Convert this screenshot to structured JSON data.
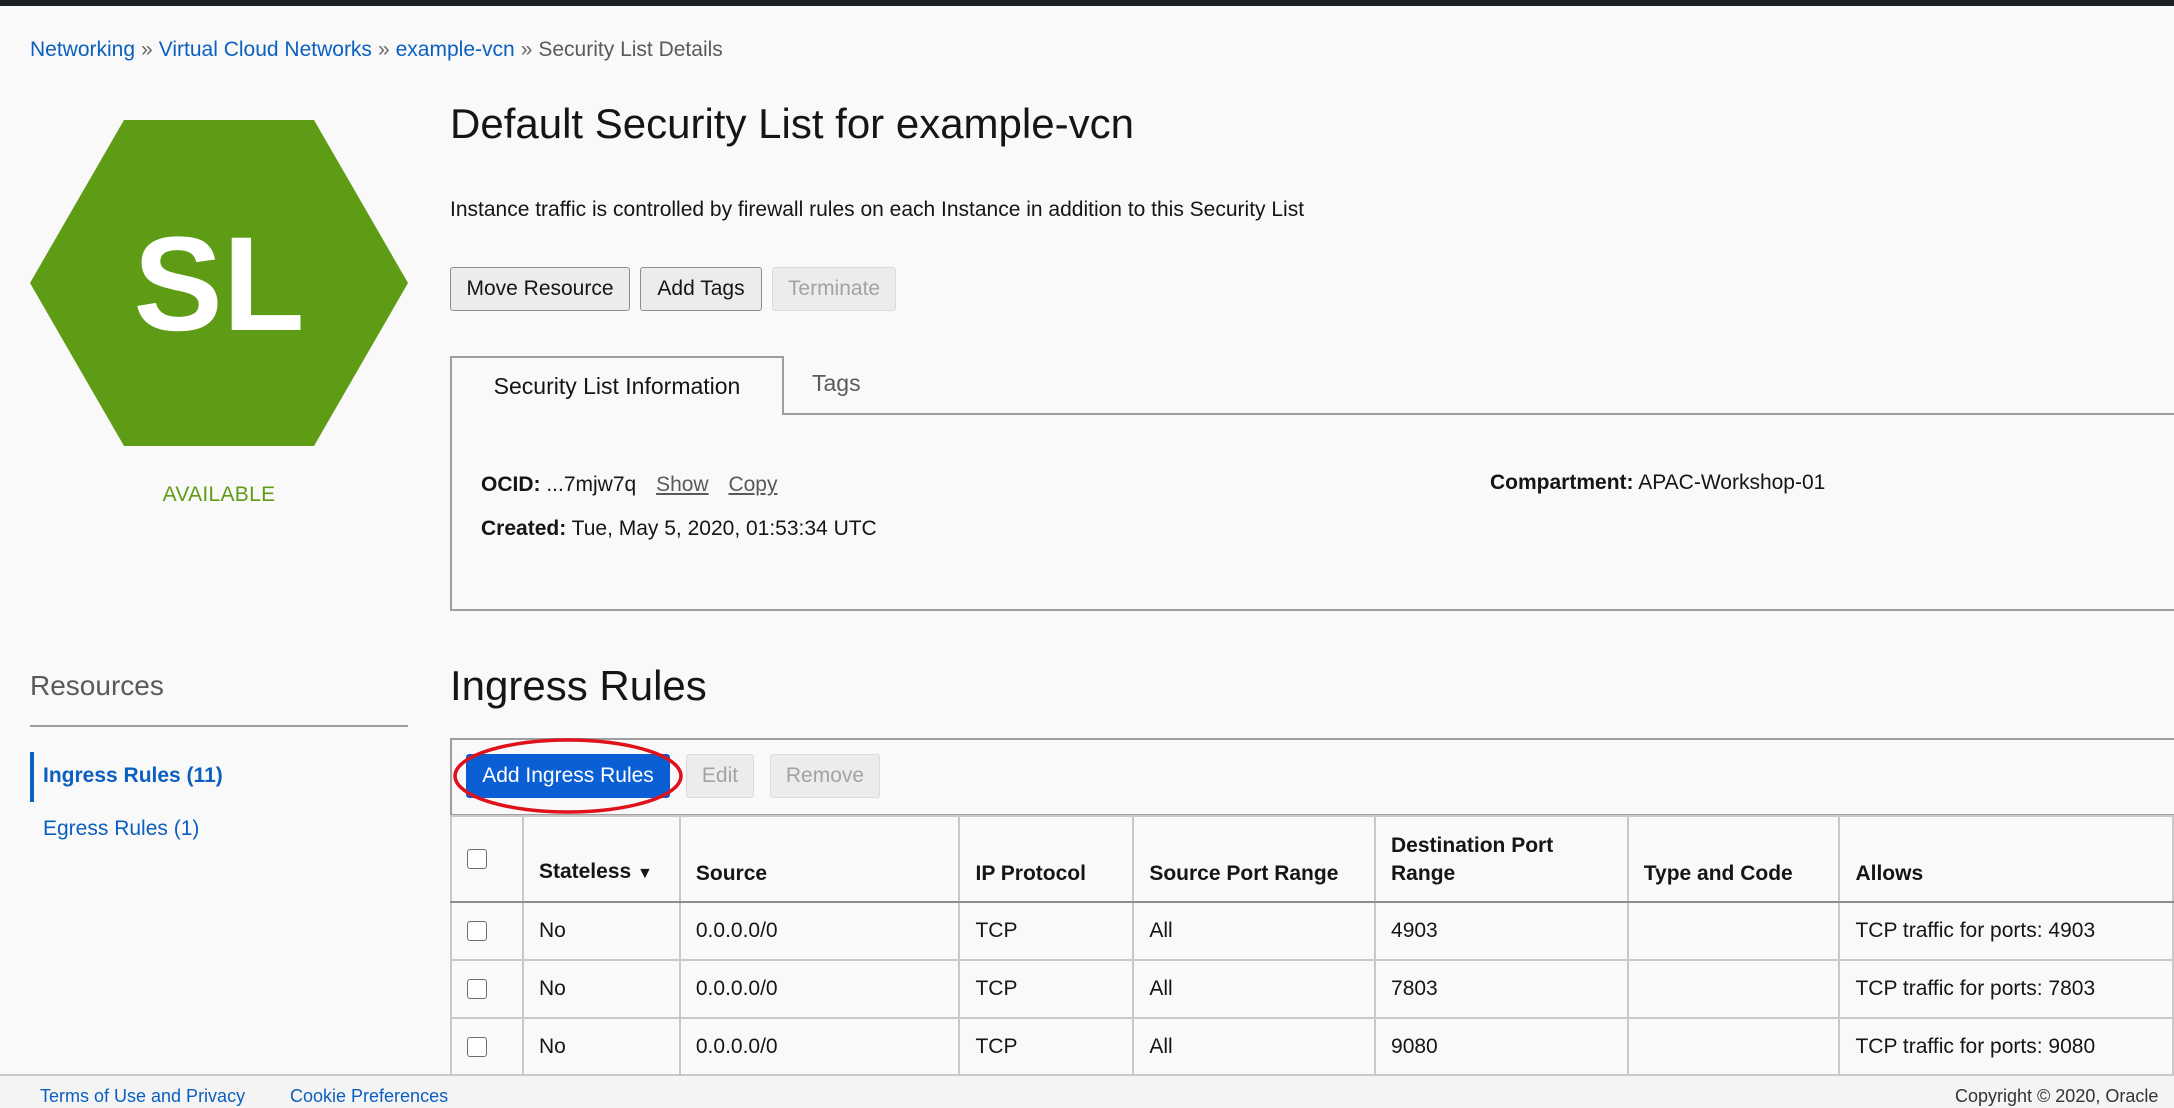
{
  "breadcrumb": {
    "items": [
      "Networking",
      "Virtual Cloud Networks",
      "example-vcn"
    ],
    "current": "Security List Details",
    "separator": "»"
  },
  "resource_icon": {
    "text": "SL",
    "color": "#5f9c16"
  },
  "status": "AVAILABLE",
  "page_title": "Default Security List for example-vcn",
  "description": "Instance traffic is controlled by firewall rules on each Instance in addition to this Security List",
  "actions": {
    "move": "Move Resource",
    "tags": "Add Tags",
    "terminate": "Terminate"
  },
  "tabs": {
    "info": "Security List Information",
    "tags": "Tags"
  },
  "info": {
    "ocid_label": "OCID:",
    "ocid_value": "...7mjw7q",
    "show": "Show",
    "copy": "Copy",
    "created_label": "Created:",
    "created_value": "Tue, May 5, 2020, 01:53:34 UTC",
    "compartment_label": "Compartment:",
    "compartment_value": "APAC-Workshop-01"
  },
  "resources": {
    "title": "Resources",
    "items": [
      "Ingress Rules (11)",
      "Egress Rules (1)"
    ]
  },
  "ingress": {
    "title": "Ingress Rules",
    "add": "Add Ingress Rules",
    "edit": "Edit",
    "remove": "Remove",
    "columns": [
      "Stateless",
      "Source",
      "IP Protocol",
      "Source Port Range",
      "Destination Port Range",
      "Type and Code",
      "Allows"
    ],
    "rows": [
      [
        "No",
        "0.0.0.0/0",
        "TCP",
        "All",
        "4903",
        "",
        "TCP traffic for ports: 4903"
      ],
      [
        "No",
        "0.0.0.0/0",
        "TCP",
        "All",
        "7803",
        "",
        "TCP traffic for ports: 7803"
      ],
      [
        "No",
        "0.0.0.0/0",
        "TCP",
        "All",
        "9080",
        "",
        "TCP traffic for ports: 9080"
      ]
    ]
  },
  "footer": {
    "terms": "Terms of Use and Privacy",
    "cookies": "Cookie Preferences",
    "copyright": "Copyright © 2020, Oracle"
  },
  "colors": {
    "accent": "#0b5fbf",
    "primary_button": "#0b5fd4",
    "available": "#5f9c16",
    "highlight": "#e0111b"
  }
}
